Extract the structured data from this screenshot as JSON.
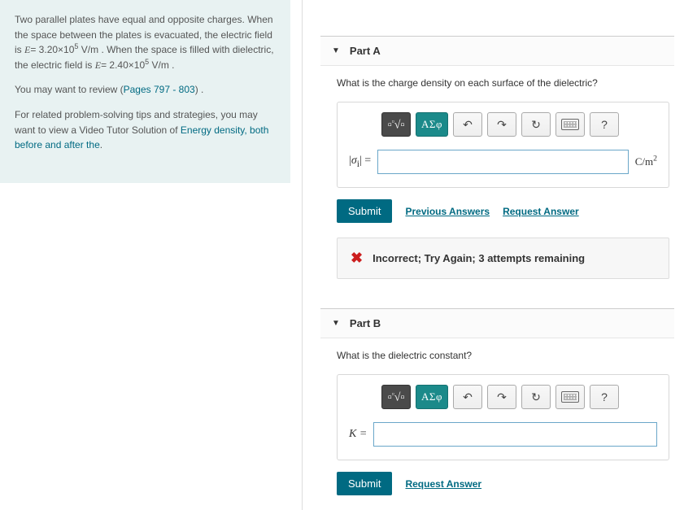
{
  "problem": {
    "paragraph1_pre": "Two parallel plates have equal and opposite charges. When the space between the plates is evacuated, the electric field is ",
    "e1_sym": "E",
    "e1_val": "= 3.20×10",
    "e1_exp": "5",
    "e1_unit": " V/m",
    "paragraph1_mid": " . When the space is filled with dielectric, the electric field is ",
    "e2_sym": "E",
    "e2_val": "= 2.40×10",
    "e2_exp": "5",
    "e2_unit": " V/m",
    "paragraph1_post": " .",
    "review_pre": "You may want to review (",
    "review_link": "Pages 797 - 803",
    "review_post": ") .",
    "tips_pre": "For related problem-solving tips and strategies, you may want to view a Video Tutor Solution of ",
    "tips_link": "Energy density, both before and after the",
    "tips_post": "."
  },
  "toolbar": {
    "greek": "ΑΣφ",
    "help": "?"
  },
  "partA": {
    "title": "Part A",
    "question": "What is the charge density on each surface of the dielectric?",
    "var_pre": "|",
    "var_sym": "σ",
    "var_sub": "i",
    "var_post": "| = ",
    "unit_base": "C/m",
    "unit_exp": "2",
    "submit": "Submit",
    "prev": "Previous Answers",
    "request": "Request Answer",
    "feedback": "Incorrect; Try Again; 3 attempts remaining"
  },
  "partB": {
    "title": "Part B",
    "question": "What is the dielectric constant?",
    "var": "K = ",
    "submit": "Submit",
    "request": "Request Answer"
  }
}
